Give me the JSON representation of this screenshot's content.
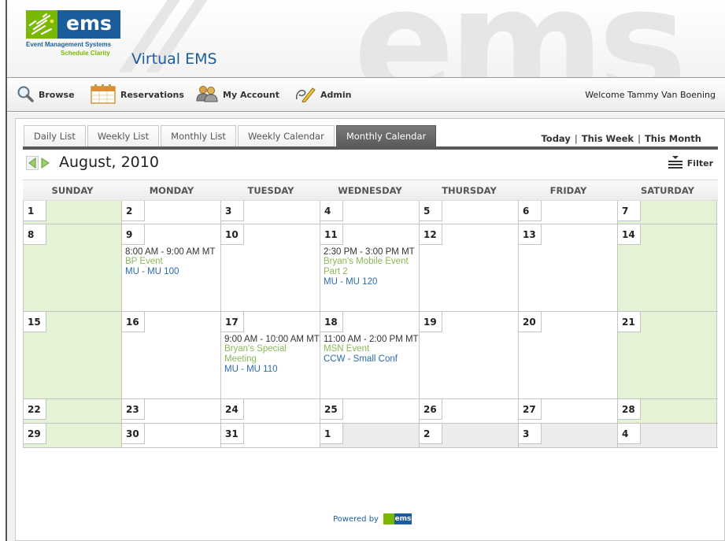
{
  "header": {
    "logo_word": "ems",
    "logo_line1": "Event Management Systems",
    "logo_line2": "Schedule Clarity",
    "app_title": "Virtual EMS",
    "watermark": "ems",
    "brand_colors": {
      "blue": "#1a5d9a",
      "green": "#7ab800"
    }
  },
  "nav": {
    "items": [
      {
        "label": "Browse",
        "icon": "magnifier-icon"
      },
      {
        "label": "Reservations",
        "icon": "calendar-icon"
      },
      {
        "label": "My Account",
        "icon": "users-icon"
      },
      {
        "label": "Admin",
        "icon": "pencil-icon"
      }
    ],
    "welcome": "Welcome Tammy Van Boening"
  },
  "tabs": [
    {
      "label": "Daily List",
      "active": false
    },
    {
      "label": "Weekly List",
      "active": false
    },
    {
      "label": "Monthly List",
      "active": false
    },
    {
      "label": "Weekly Calendar",
      "active": false
    },
    {
      "label": "Monthly Calendar",
      "active": true
    }
  ],
  "quick_links": [
    "Today",
    "This Week",
    "This Month"
  ],
  "calendar": {
    "month_title": "August, 2010",
    "filter_label": "Filter",
    "day_names": [
      "SUNDAY",
      "MONDAY",
      "TUESDAY",
      "WEDNESDAY",
      "THURSDAY",
      "FRIDAY",
      "SATURDAY"
    ],
    "weeks": [
      [
        "1",
        "2",
        "3",
        "4",
        "5",
        "6",
        "7"
      ],
      [
        "8",
        "9",
        "10",
        "11",
        "12",
        "13",
        "14"
      ],
      [
        "15",
        "16",
        "17",
        "18",
        "19",
        "20",
        "21"
      ],
      [
        "22",
        "23",
        "24",
        "25",
        "26",
        "27",
        "28"
      ],
      [
        "29",
        "30",
        "31",
        "1",
        "2",
        "3",
        "4"
      ]
    ],
    "events": [
      {
        "day": "9",
        "time": "8:00 AM - 9:00 AM MT",
        "name": "BP Event",
        "room": "MU - MU 100"
      },
      {
        "day": "11",
        "time": "2:30 PM - 3:00 PM MT",
        "name": "Bryan's Mobile Event Part 2",
        "room": "MU - MU 120"
      },
      {
        "day": "17",
        "time": "9:00 AM - 10:00 AM MT",
        "name": "Bryan's Special Meeting",
        "room": "MU - MU 110"
      },
      {
        "day": "18",
        "time": "11:00 AM - 2:00 PM MT",
        "name": "MSN Event",
        "room": "CCW - Small Conf"
      }
    ],
    "colors": {
      "weekend": "#e4f3d6",
      "other_month": "#ececec",
      "event_name": "#8ab956",
      "event_room": "#2a6bb0"
    }
  },
  "footer": {
    "powered_by": "Powered by",
    "logo_word": "ems"
  }
}
